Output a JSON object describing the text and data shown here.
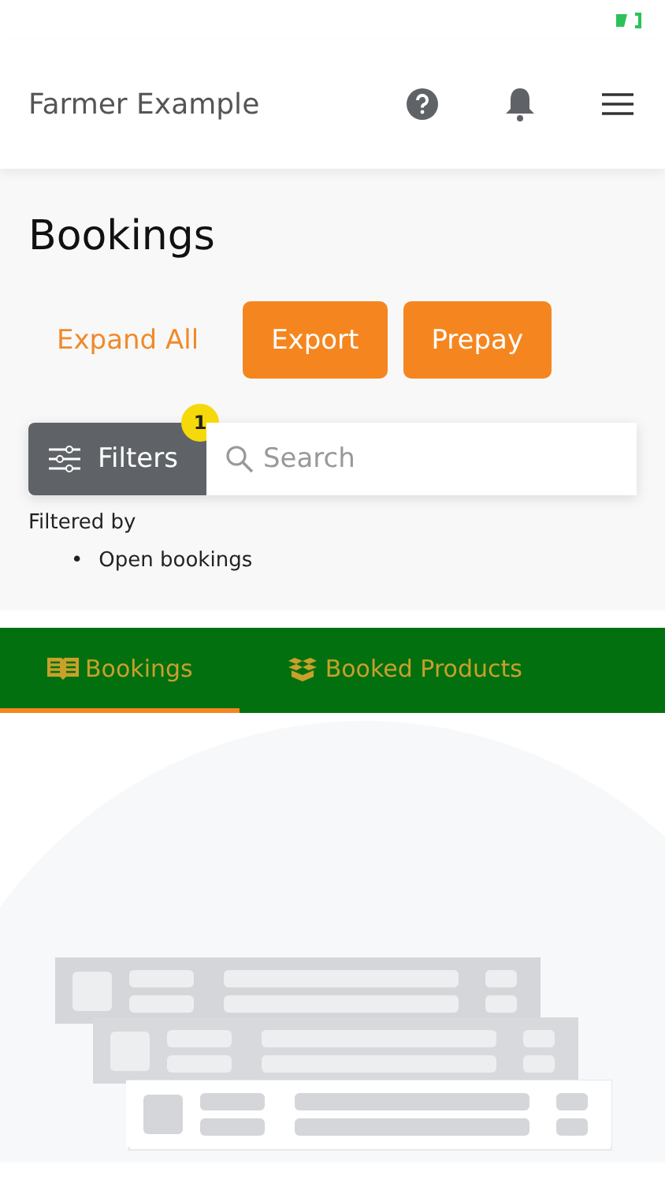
{
  "header": {
    "title": "Farmer Example"
  },
  "page": {
    "title": "Bookings",
    "actions": [
      {
        "label": "Expand All",
        "kind": "link"
      },
      {
        "label": "Export",
        "kind": "button"
      },
      {
        "label": "Prepay",
        "kind": "button"
      }
    ]
  },
  "filters": {
    "label": "Filters",
    "count": "1",
    "search_placeholder": "Search",
    "filtered_by": "Filtered by",
    "applied": [
      {
        "bullet": "•",
        "label": "Open bookings"
      }
    ]
  },
  "tabs": [
    {
      "label": "Bookings",
      "kind": "book",
      "selected": true
    },
    {
      "label": "Booked Products",
      "kind": "boxes",
      "selected": false
    }
  ]
}
